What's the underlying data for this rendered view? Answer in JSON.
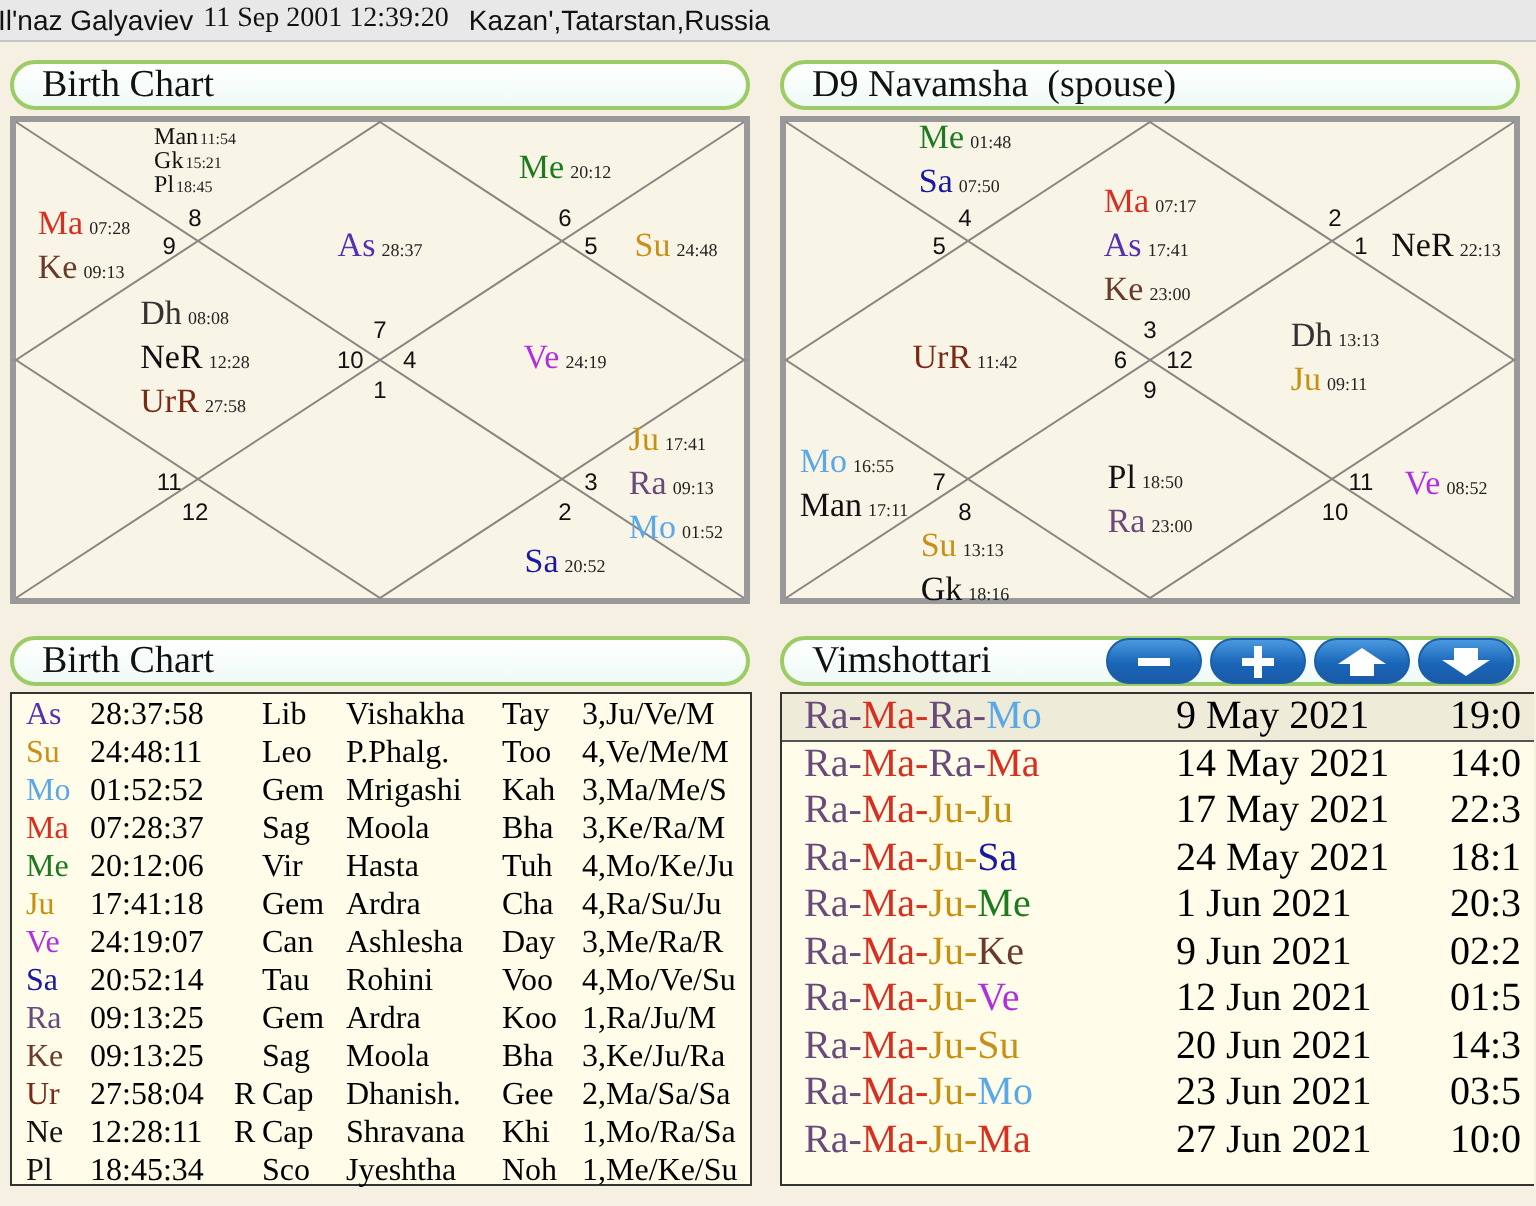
{
  "header": {
    "name": "Il'naz Galyaviev",
    "datetime": "11 Sep 2001 12:39:20",
    "place": "Kazan',Tatarstan,Russia"
  },
  "charts": [
    {
      "title": "Birth Chart",
      "houses": [
        {
          "sign": "7",
          "planets": [
            {
              "name": "As",
              "degree": "28:37",
              "color": "#5530b0"
            }
          ]
        },
        {
          "sign": "8",
          "planets": [
            {
              "name": "Man",
              "degree": "11:54",
              "color": "#111111"
            },
            {
              "name": "Gk",
              "degree": "15:21",
              "color": "#111111"
            },
            {
              "name": "Pl",
              "degree": "18:45",
              "color": "#111111"
            }
          ]
        },
        {
          "sign": "9",
          "planets": [
            {
              "name": "Ma",
              "degree": "07:28",
              "color": "#d83020"
            },
            {
              "name": "Ke",
              "degree": "09:13",
              "color": "#6a3a2a"
            }
          ]
        },
        {
          "sign": "10",
          "planets": [
            {
              "name": "Dh",
              "degree": "08:08",
              "color": "#333333"
            },
            {
              "name": "NeR",
              "degree": "12:28",
              "color": "#111111"
            },
            {
              "name": "UrR",
              "degree": "27:58",
              "color": "#7a2818"
            }
          ]
        },
        {
          "sign": "11"
        },
        {
          "sign": "12"
        },
        {
          "sign": "1"
        },
        {
          "sign": "2",
          "planets": [
            {
              "name": "Sa",
              "degree": "20:52",
              "color": "#1a1aa0"
            }
          ]
        },
        {
          "sign": "3",
          "planets": [
            {
              "name": "Ju",
              "degree": "17:41",
              "color": "#c89010"
            },
            {
              "name": "Ra",
              "degree": "09:13",
              "color": "#6a4a7a"
            },
            {
              "name": "Mo",
              "degree": "01:52",
              "color": "#5aa8e8"
            }
          ]
        },
        {
          "sign": "4",
          "planets": [
            {
              "name": "Ve",
              "degree": "24:19",
              "color": "#b030e0"
            }
          ]
        },
        {
          "sign": "5",
          "planets": [
            {
              "name": "Su",
              "degree": "24:48",
              "color": "#c8901a"
            }
          ]
        },
        {
          "sign": "6",
          "planets": [
            {
              "name": "Me",
              "degree": "20:12",
              "color": "#1e7a1e"
            }
          ]
        }
      ]
    },
    {
      "title": "D9 Navamsha  (spouse)",
      "houses": [
        {
          "sign": "3",
          "planets": [
            {
              "name": "Ma",
              "degree": "07:17",
              "color": "#d83020"
            },
            {
              "name": "As",
              "degree": "17:41",
              "color": "#5530b0"
            },
            {
              "name": "Ke",
              "degree": "23:00",
              "color": "#6a3a2a"
            }
          ]
        },
        {
          "sign": "4",
          "planets": [
            {
              "name": "Me",
              "degree": "01:48",
              "color": "#1e7a1e"
            },
            {
              "name": "Sa",
              "degree": "07:50",
              "color": "#1a1aa0"
            }
          ]
        },
        {
          "sign": "5"
        },
        {
          "sign": "6",
          "planets": [
            {
              "name": "UrR",
              "degree": "11:42",
              "color": "#7a2818"
            }
          ]
        },
        {
          "sign": "7",
          "planets": [
            {
              "name": "Mo",
              "degree": "16:55",
              "color": "#5aa8e8"
            },
            {
              "name": "Man",
              "degree": "17:11",
              "color": "#111111"
            }
          ]
        },
        {
          "sign": "8",
          "planets": [
            {
              "name": "Su",
              "degree": "13:13",
              "color": "#c8901a"
            },
            {
              "name": "Gk",
              "degree": "18:16",
              "color": "#111111"
            }
          ]
        },
        {
          "sign": "9",
          "planets": [
            {
              "name": "Pl",
              "degree": "18:50",
              "color": "#111111"
            },
            {
              "name": "Ra",
              "degree": "23:00",
              "color": "#6a4a7a"
            }
          ]
        },
        {
          "sign": "10"
        },
        {
          "sign": "11",
          "planets": [
            {
              "name": "Ve",
              "degree": "08:52",
              "color": "#b030e0"
            }
          ]
        },
        {
          "sign": "12",
          "planets": [
            {
              "name": "Dh",
              "degree": "13:13",
              "color": "#333333"
            },
            {
              "name": "Ju",
              "degree": "09:11",
              "color": "#c89010"
            }
          ]
        },
        {
          "sign": "1",
          "planets": [
            {
              "name": "NeR",
              "degree": "22:13",
              "color": "#111111"
            }
          ]
        },
        {
          "sign": "2"
        }
      ]
    }
  ],
  "planet_table": {
    "title": "Birth Chart",
    "rows": [
      {
        "planet": "As",
        "color": "#5530b0",
        "degree": "28:37:58",
        "sign": "Lib",
        "nakshatra": "Vishakha",
        "syllable": "Tay",
        "pada": "3,Ju/Ve/M"
      },
      {
        "planet": "Su",
        "color": "#c8901a",
        "degree": "24:48:11",
        "sign": "Leo",
        "nakshatra": "P.Phalg.",
        "syllable": "Too",
        "pada": "4,Ve/Me/M"
      },
      {
        "planet": "Mo",
        "color": "#5aa8e8",
        "degree": "01:52:52",
        "sign": "Gem",
        "nakshatra": "Mrigashi",
        "syllable": "Kah",
        "pada": "3,Ma/Me/S"
      },
      {
        "planet": "Ma",
        "color": "#d83020",
        "degree": "07:28:37",
        "sign": "Sag",
        "nakshatra": "Moola",
        "syllable": "Bha",
        "pada": "3,Ke/Ra/M"
      },
      {
        "planet": "Me",
        "color": "#1e7a1e",
        "degree": "20:12:06",
        "sign": "Vir",
        "nakshatra": "Hasta",
        "syllable": "Tuh",
        "pada": "4,Mo/Ke/Ju"
      },
      {
        "planet": "Ju",
        "color": "#c89010",
        "degree": "17:41:18",
        "sign": "Gem",
        "nakshatra": "Ardra",
        "syllable": "Cha",
        "pada": "4,Ra/Su/Ju"
      },
      {
        "planet": "Ve",
        "color": "#b030e0",
        "degree": "24:19:07",
        "sign": "Can",
        "nakshatra": "Ashlesha",
        "syllable": "Day",
        "pada": "3,Me/Ra/R"
      },
      {
        "planet": "Sa",
        "color": "#1a1aa0",
        "degree": "20:52:14",
        "sign": "Tau",
        "nakshatra": "Rohini",
        "syllable": "Voo",
        "pada": "4,Mo/Ve/Su"
      },
      {
        "planet": "Ra",
        "color": "#6a4a7a",
        "degree": "09:13:25",
        "sign": "Gem",
        "nakshatra": "Ardra",
        "syllable": "Koo",
        "pada": "1,Ra/Ju/M"
      },
      {
        "planet": "Ke",
        "color": "#6a3a2a",
        "degree": "09:13:25",
        "sign": "Sag",
        "nakshatra": "Moola",
        "syllable": "Bha",
        "pada": "3,Ke/Ju/Ra"
      },
      {
        "planet": "Ur",
        "color": "#7a2818",
        "degree": "27:58:04",
        "retro": "R",
        "sign": "Cap",
        "nakshatra": "Dhanish.",
        "syllable": "Gee",
        "pada": "2,Ma/Sa/Sa"
      },
      {
        "planet": "Ne",
        "color": "#111111",
        "degree": "12:28:11",
        "retro": "R",
        "sign": "Cap",
        "nakshatra": "Shravana",
        "syllable": "Khi",
        "pada": "1,Mo/Ra/Sa"
      },
      {
        "planet": "Pl",
        "color": "#111111",
        "degree": "18:45:34",
        "sign": "Sco",
        "nakshatra": "Jyeshtha",
        "syllable": "Noh",
        "pada": "1,Me/Ke/Su"
      }
    ]
  },
  "dasha": {
    "title": "Vimshottari",
    "buttons": [
      {
        "kind": "minus"
      },
      {
        "kind": "plus"
      },
      {
        "kind": "up"
      },
      {
        "kind": "down"
      }
    ],
    "rows": [
      {
        "selected": true,
        "segments": [
          {
            "text": "Ra-",
            "color": "#6a4a7a"
          },
          {
            "text": "Ma-",
            "color": "#d83020"
          },
          {
            "text": "Ra-",
            "color": "#6a4a7a"
          },
          {
            "text": "Mo",
            "color": "#5aa8e8"
          }
        ],
        "date": "9 May 2021",
        "time": "19:0"
      },
      {
        "selected": false,
        "segments": [
          {
            "text": "Ra-",
            "color": "#6a4a7a"
          },
          {
            "text": "Ma-",
            "color": "#d83020"
          },
          {
            "text": "Ra-",
            "color": "#6a4a7a"
          },
          {
            "text": "Ma",
            "color": "#d83020"
          }
        ],
        "date": "14 May 2021",
        "time": "14:0"
      },
      {
        "selected": false,
        "segments": [
          {
            "text": "Ra-",
            "color": "#6a4a7a"
          },
          {
            "text": "Ma-",
            "color": "#d83020"
          },
          {
            "text": "Ju-",
            "color": "#c89010"
          },
          {
            "text": "Ju",
            "color": "#c89010"
          }
        ],
        "date": "17 May 2021",
        "time": "22:3"
      },
      {
        "selected": false,
        "segments": [
          {
            "text": "Ra-",
            "color": "#6a4a7a"
          },
          {
            "text": "Ma-",
            "color": "#d83020"
          },
          {
            "text": "Ju-",
            "color": "#c89010"
          },
          {
            "text": "Sa",
            "color": "#1a1aa0"
          }
        ],
        "date": "24 May 2021",
        "time": "18:1"
      },
      {
        "selected": false,
        "segments": [
          {
            "text": "Ra-",
            "color": "#6a4a7a"
          },
          {
            "text": "Ma-",
            "color": "#d83020"
          },
          {
            "text": "Ju-",
            "color": "#c89010"
          },
          {
            "text": "Me",
            "color": "#1e7a1e"
          }
        ],
        "date": "1 Jun 2021",
        "time": "20:3"
      },
      {
        "selected": false,
        "segments": [
          {
            "text": "Ra-",
            "color": "#6a4a7a"
          },
          {
            "text": "Ma-",
            "color": "#d83020"
          },
          {
            "text": "Ju-",
            "color": "#c89010"
          },
          {
            "text": "Ke",
            "color": "#6a3a2a"
          }
        ],
        "date": "9 Jun 2021",
        "time": "02:2"
      },
      {
        "selected": false,
        "segments": [
          {
            "text": "Ra-",
            "color": "#6a4a7a"
          },
          {
            "text": "Ma-",
            "color": "#d83020"
          },
          {
            "text": "Ju-",
            "color": "#c89010"
          },
          {
            "text": "Ve",
            "color": "#b030e0"
          }
        ],
        "date": "12 Jun 2021",
        "time": "01:5"
      },
      {
        "selected": false,
        "segments": [
          {
            "text": "Ra-",
            "color": "#6a4a7a"
          },
          {
            "text": "Ma-",
            "color": "#d83020"
          },
          {
            "text": "Ju-",
            "color": "#c89010"
          },
          {
            "text": "Su",
            "color": "#c8901a"
          }
        ],
        "date": "20 Jun 2021",
        "time": "14:3"
      },
      {
        "selected": false,
        "segments": [
          {
            "text": "Ra-",
            "color": "#6a4a7a"
          },
          {
            "text": "Ma-",
            "color": "#d83020"
          },
          {
            "text": "Ju-",
            "color": "#c89010"
          },
          {
            "text": "Mo",
            "color": "#5aa8e8"
          }
        ],
        "date": "23 Jun 2021",
        "time": "03:5"
      },
      {
        "selected": false,
        "segments": [
          {
            "text": "Ra-",
            "color": "#6a4a7a"
          },
          {
            "text": "Ma-",
            "color": "#d83020"
          },
          {
            "text": "Ju-",
            "color": "#c89010"
          },
          {
            "text": "Ma",
            "color": "#d83020"
          }
        ],
        "date": "27 Jun 2021",
        "time": "10:0"
      }
    ]
  }
}
